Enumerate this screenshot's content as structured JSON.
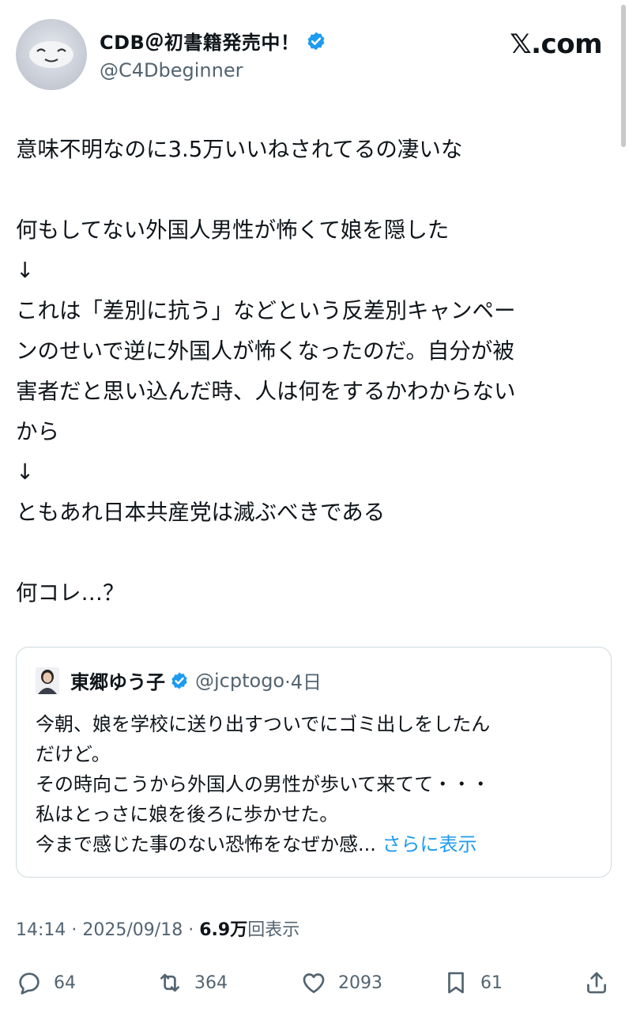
{
  "author": {
    "display_name": "CDB＠初書籍発売中！",
    "handle": "@C4Dbeginner"
  },
  "brand": {
    "site": "𝕏.com"
  },
  "tweet": {
    "lines": [
      "意味不明なのに3.5万いいねされてるの凄いな",
      "",
      "何もしてない外国人男性が怖くて娘を隠した",
      "↓",
      "これは「差別に抗う」などという反差別キャンペー",
      "ンのせいで逆に外国人が怖くなったのだ。自分が被",
      "害者だと思い込んだ時、人は何をするかわからない",
      "から",
      "↓",
      "ともあれ日本共産党は滅ぶべきである",
      "",
      "何コレ…？"
    ]
  },
  "quote": {
    "name": "東郷ゆう子",
    "handle": "@jcptogo",
    "time": "·4日",
    "lines": [
      "今朝、娘を学校に送り出すついでにゴミ出しをしたん",
      "だけど。",
      "その時向こうから外国人の男性が歩いて来てて・・・",
      "私はとっさに娘を後ろに歩かせた。",
      "今まで感じた事のない恐怖をなぜか感..."
    ],
    "show_more": "さらに表示"
  },
  "meta": {
    "time": "14:14",
    "date": "2025/09/18",
    "sep": "·",
    "views": "6.9万",
    "views_suffix": "回表示"
  },
  "actions": {
    "replies": "64",
    "retweets": "364",
    "likes": "2093",
    "bookmarks": "61"
  },
  "colors": {
    "accent": "#1d9bf0",
    "secondary_text": "#536471",
    "border": "#cfd9de"
  }
}
